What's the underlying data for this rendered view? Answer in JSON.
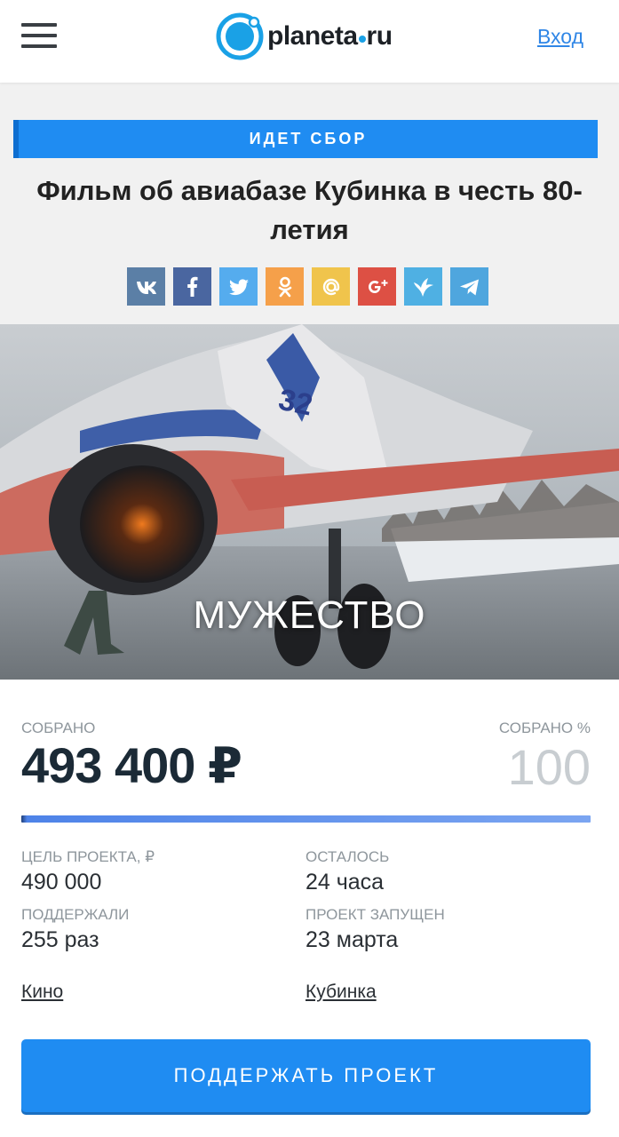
{
  "header": {
    "logo_text_a": "planeta",
    "logo_text_b": "ru",
    "login_label": "Вход",
    "brand_color": "#1aa1e6"
  },
  "project": {
    "status": "ИДЕТ СБОР",
    "title": "Фильм об авиабазе Кубинка в честь 80-летия",
    "share_buttons": [
      {
        "name": "vk",
        "icon": "vk-icon",
        "color": "#5b7fa6"
      },
      {
        "name": "facebook",
        "icon": "facebook-icon",
        "color": "#4a66a0"
      },
      {
        "name": "twitter",
        "icon": "twitter-icon",
        "color": "#55acee"
      },
      {
        "name": "odnoklassniki",
        "icon": "odnoklassniki-icon",
        "color": "#f5a04a"
      },
      {
        "name": "mail",
        "icon": "mail-at-icon",
        "color": "#f0c44c"
      },
      {
        "name": "google-plus",
        "icon": "google-plus-icon",
        "color": "#dd5044"
      },
      {
        "name": "liveinternet",
        "icon": "bird-icon",
        "color": "#4fb0e3"
      },
      {
        "name": "telegram",
        "icon": "telegram-icon",
        "color": "#4fa6de"
      }
    ],
    "hero_caption": "МУЖЕСТВО"
  },
  "stats": {
    "collected_label": "СОБРАНО",
    "collected_value": "493 400 ₽",
    "collected_pct_label": "СОБРАНО %",
    "collected_pct_value": "100",
    "progress_fraction": 1.0,
    "goal_label": "ЦЕЛЬ ПРОЕКТА, ₽",
    "goal_value": "490 000",
    "remaining_label": "ОСТАЛОСЬ",
    "remaining_value": "24 часа",
    "backers_label": "ПОДДЕРЖАЛИ",
    "backers_value": "255 раз",
    "launched_label": "ПРОЕКТ ЗАПУЩЕН",
    "launched_value": "23 марта",
    "category": "Кино",
    "city": "Кубинка",
    "support_button": "ПОДДЕРЖАТЬ ПРОЕКТ"
  }
}
